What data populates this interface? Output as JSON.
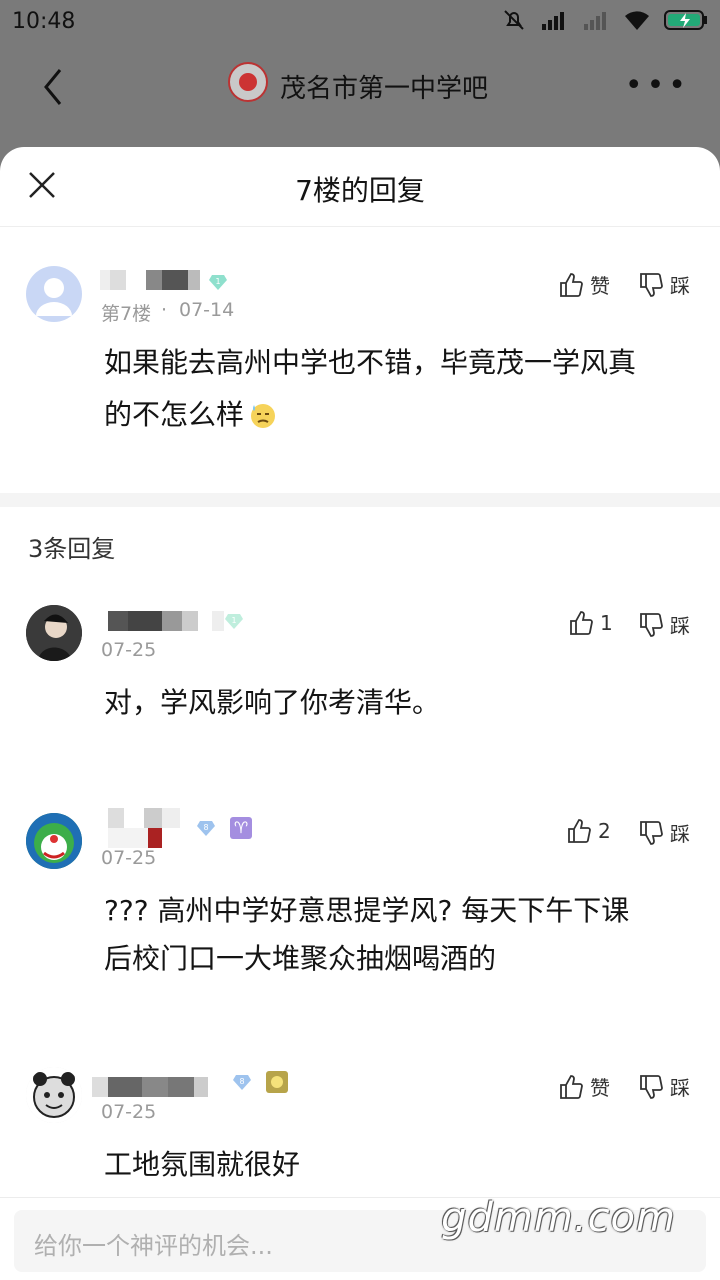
{
  "status_bar": {
    "time": "10:48",
    "icons": [
      "mute-icon",
      "hd-signal-icon",
      "signal-icon",
      "wifi-icon",
      "battery-charging-icon"
    ]
  },
  "top_bar": {
    "forum_title": "茂名市第一中学吧"
  },
  "sheet": {
    "title": "7楼的回复",
    "main_post": {
      "floor": "第7楼",
      "separator": "·",
      "date": "07-14",
      "level": "1",
      "content_line1": "如果能去高州中学也不错，毕竟茂一学风真",
      "content_line2": "的不怎么样",
      "like_label": "赞",
      "dislike_label": "踩"
    },
    "reply_count": "3条回复",
    "replies": [
      {
        "date": "07-25",
        "level": "1",
        "content_line1": "对，学风影响了你考清华。",
        "content_line2": "",
        "like_label": "1",
        "dislike_label": "踩"
      },
      {
        "date": "07-25",
        "level": "8",
        "zodiac": "♈",
        "content_line1": "??? 高州中学好意思提学风? 每天下午下课",
        "content_line2": "后校门口一大堆聚众抽烟喝酒的",
        "like_label": "2",
        "dislike_label": "踩"
      },
      {
        "date": "07-25",
        "level": "8",
        "content_line1": "工地氛围就很好",
        "content_line2": "",
        "like_label": "赞",
        "dislike_label": "踩"
      }
    ],
    "input_placeholder": "给你一个神评的机会...",
    "watermark": "gdmm.com"
  },
  "colors": {
    "sheet_bg": "#ffffff",
    "overlay": "#7a7a7a",
    "meta_text": "#9a9a9a",
    "level_badge": "#7fd9c4"
  }
}
